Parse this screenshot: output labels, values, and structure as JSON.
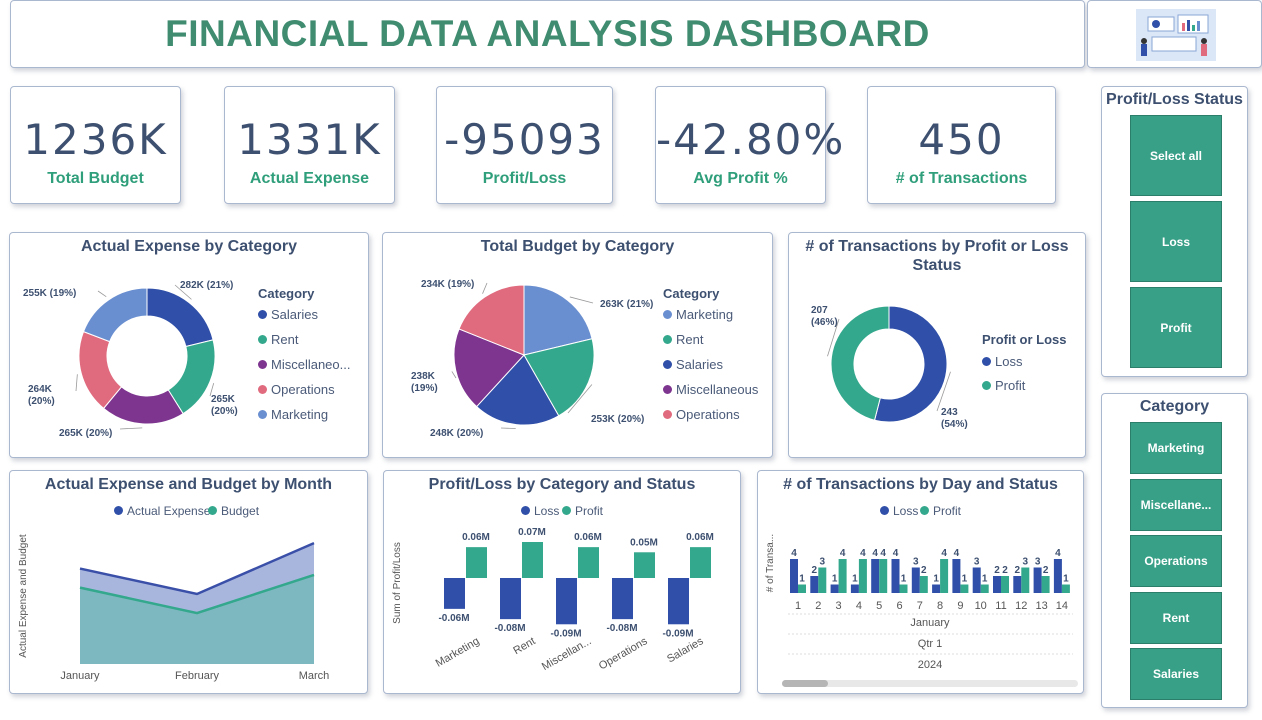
{
  "header": {
    "title": "FINANCIAL DATA ANALYSIS DASHBOARD",
    "logo_icon": "dashboard-illustration-icon"
  },
  "cards": [
    {
      "value": "1236K",
      "label": "Total Budget"
    },
    {
      "value": "1331K",
      "label": "Actual Expense"
    },
    {
      "value": "-95093",
      "label": "Profit/Loss"
    },
    {
      "value": "-42.80%",
      "label": "Avg Profit %"
    },
    {
      "value": "450",
      "label": "# of Transactions"
    }
  ],
  "colors": {
    "salaries": "#2f4fa8",
    "rent": "#34a88c",
    "misc": "#7e3590",
    "operations": "#e06a7e",
    "marketing": "#6a8fd0",
    "loss": "#2f4fa8",
    "profit": "#34a88c"
  },
  "slicer_status": {
    "title": "Profit/Loss Status",
    "items": [
      "Select all",
      "Loss",
      "Profit"
    ]
  },
  "slicer_category": {
    "title": "Category",
    "items": [
      "Marketing",
      "Miscellane...",
      "Operations",
      "Rent",
      "Salaries"
    ]
  },
  "chart_data": [
    {
      "type": "pie",
      "variant": "donut",
      "title": "Actual Expense by Category",
      "legend_title": "Category",
      "legend_labels": [
        "Salaries",
        "Rent",
        "Miscellaneo...",
        "Operations",
        "Marketing"
      ],
      "categories": [
        "Salaries",
        "Rent",
        "Miscellaneous",
        "Operations",
        "Marketing"
      ],
      "values": [
        282,
        265,
        265,
        264,
        255
      ],
      "unit": "K",
      "data_labels": [
        "282K (21%)",
        "265K (20%)",
        "265K (20%)",
        "264K (20%)",
        "255K (19%)"
      ]
    },
    {
      "type": "pie",
      "title": "Total Budget by Category",
      "legend_title": "Category",
      "categories": [
        "Marketing",
        "Rent",
        "Salaries",
        "Miscellaneous",
        "Operations"
      ],
      "values": [
        263,
        253,
        248,
        238,
        234
      ],
      "unit": "K",
      "data_labels": [
        "263K (21%)",
        "253K (20%)",
        "248K (20%)",
        "238K (19%)",
        "234K (19%)"
      ]
    },
    {
      "type": "pie",
      "variant": "donut",
      "title": "# of Transactions by Profit or Loss Status",
      "legend_title": "Profit or Loss",
      "categories": [
        "Loss",
        "Profit"
      ],
      "values": [
        243,
        207
      ],
      "data_labels": [
        "243 (54%)",
        "207 (46%)"
      ]
    },
    {
      "type": "area",
      "title": "Actual Expense and Budget by Month",
      "ylabel": "Actual Expense and Budget",
      "categories": [
        "January",
        "February",
        "March"
      ],
      "series": [
        {
          "name": "Actual Expense",
          "values": [
            450,
            410,
            490
          ]
        },
        {
          "name": "Budget",
          "values": [
            420,
            380,
            440
          ]
        }
      ],
      "unit": "K",
      "legend": "top"
    },
    {
      "type": "bar",
      "title": "Profit/Loss by Category and Status",
      "ylabel": "Sum of Profit/Loss",
      "categories": [
        "Marketing",
        "Rent",
        "Miscellan...",
        "Operations",
        "Salaries"
      ],
      "series": [
        {
          "name": "Loss",
          "values": [
            -0.06,
            -0.08,
            -0.09,
            -0.08,
            -0.09
          ],
          "labels": [
            "-0.06M",
            "-0.08M",
            "-0.09M",
            "-0.08M",
            "-0.09M"
          ]
        },
        {
          "name": "Profit",
          "values": [
            0.06,
            0.07,
            0.06,
            0.05,
            0.06
          ],
          "labels": [
            "0.06M",
            "0.07M",
            "0.06M",
            "0.05M",
            "0.06M"
          ]
        }
      ],
      "legend": "top"
    },
    {
      "type": "bar",
      "title": "# of Transactions by Day and Status",
      "ylabel": "# of Transa...",
      "categories": [
        "1",
        "2",
        "3",
        "4",
        "5",
        "6",
        "7",
        "8",
        "9",
        "10",
        "11",
        "12",
        "13",
        "14"
      ],
      "x_hierarchy": [
        "January",
        "Qtr 1",
        "2024"
      ],
      "series": [
        {
          "name": "Loss",
          "values": [
            4,
            2,
            1,
            1,
            4,
            4,
            3,
            1,
            4,
            3,
            2,
            2,
            3,
            4
          ]
        },
        {
          "name": "Profit",
          "values": [
            1,
            3,
            4,
            4,
            4,
            1,
            2,
            4,
            1,
            1,
            2,
            3,
            2,
            1
          ]
        }
      ],
      "legend": "top"
    }
  ]
}
